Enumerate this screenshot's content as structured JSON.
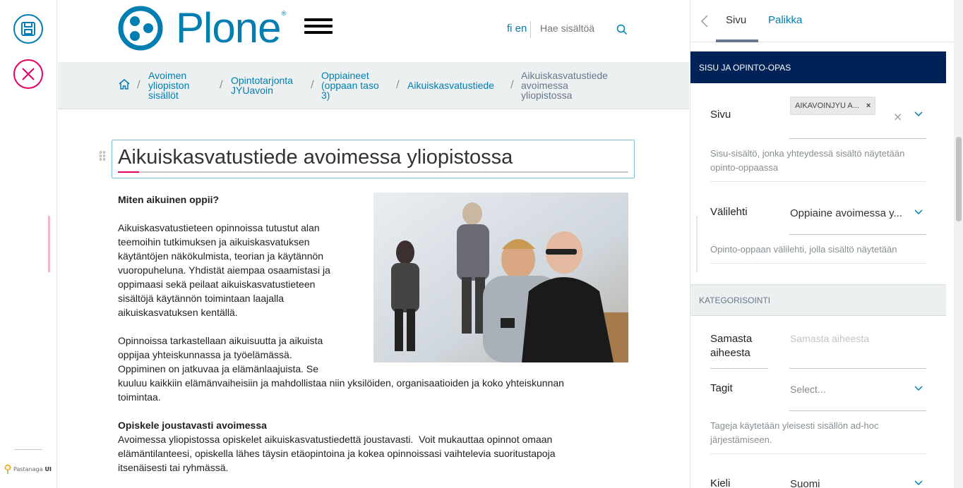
{
  "toolbar": {
    "brand_name": "Pastanaga",
    "brand_suffix": "UI"
  },
  "header": {
    "logo_text": "Plone",
    "logo_mark": "®",
    "languages": [
      "fi",
      "en"
    ],
    "search_placeholder": "Hae sisältöä"
  },
  "breadcrumb": [
    {
      "label": "Avoimen\nyliopiston\nsisällöt"
    },
    {
      "label": "Opintotarjonta\nJYUavoin"
    },
    {
      "label": "Oppiaineet\n(oppaan taso\n3)"
    },
    {
      "label": "Aikuiskasvatustiede"
    },
    {
      "label": "Aikuiskasvatustiede\navoimessa\nyliopistossa"
    }
  ],
  "main": {
    "title": "Aikuiskasvatustiede avoimessa yliopistossa",
    "heading1": "Miten aikuinen oppii?",
    "para1": "Aikuiskasvatustieteen opinnoissa tutustut alan\nteemoihin tutkimuksen ja aikuiskasvatuksen\nkäytäntöjen näkökulmista, teorian ja käytännön\nvuoropuheluna. Yhdistät aiempaa osaamistasi ja\noppimaasi sekä peilaat aikuiskasvatustieteen\nsisältöjä käytännön toimintaan laajalla\naikuiskasvatuksen kentällä.",
    "para2a": "Opinnoissa tarkastellaan aikuisuutta ja aikuista\noppijaa yhteiskunnassa ja työelämässä.\nOppiminen on jatkuvaa ja elämänlaajuista. Se",
    "para2b": "kuuluu kaikkiin elämänvaiheisiin ja mahdollistaa niin yksilöiden, organisaatioiden ja koko yhteiskunnan\ntoimintaa.",
    "heading2": "Opiskele joustavasti avoimessa",
    "para3": "Avoimessa yliopistossa opiskelet aikuiskasvatustiedettä joustavasti.  Voit mukauttaa opinnot omaan\nelämäntilanteesi, opiskella lähes täysin etäopintoina ja kokea opinnoissasi vaihtelevia suoritustapoja\nitsenäisesti tai ryhmässä."
  },
  "sidebar": {
    "tabs": [
      "Sivu",
      "Palikka"
    ],
    "section1": "SISU JA OPINTO-OPAS",
    "field_sivu_label": "Sivu",
    "field_sivu_chip": "AIKAVOINJYU A...",
    "field_sivu_chip_remove": "×",
    "field_sivu_clear": "×",
    "field_sivu_help": "Sisu-sisältö, jonka yhteydessä sisältö näytetään\nopinto-oppaassa",
    "field_valilehti_label": "Välilehti",
    "field_valilehti_value": "Oppiaine avoimessa y...",
    "field_valilehti_help": "Opinto-oppaan välilehti, jolla sisältö näytetään",
    "section2": "KATEGORISOINTI",
    "field_samasta_label": "Samasta\naiheesta",
    "field_samasta_placeholder": "Samasta aiheesta",
    "field_tagit_label": "Tagit",
    "field_tagit_placeholder": "Select...",
    "field_tagit_help": "Tageja käytetään yleisesti sisällön ad-hoc\njärjestämiseen.",
    "field_kieli_label": "Kieli",
    "field_kieli_value": "Suomi"
  }
}
